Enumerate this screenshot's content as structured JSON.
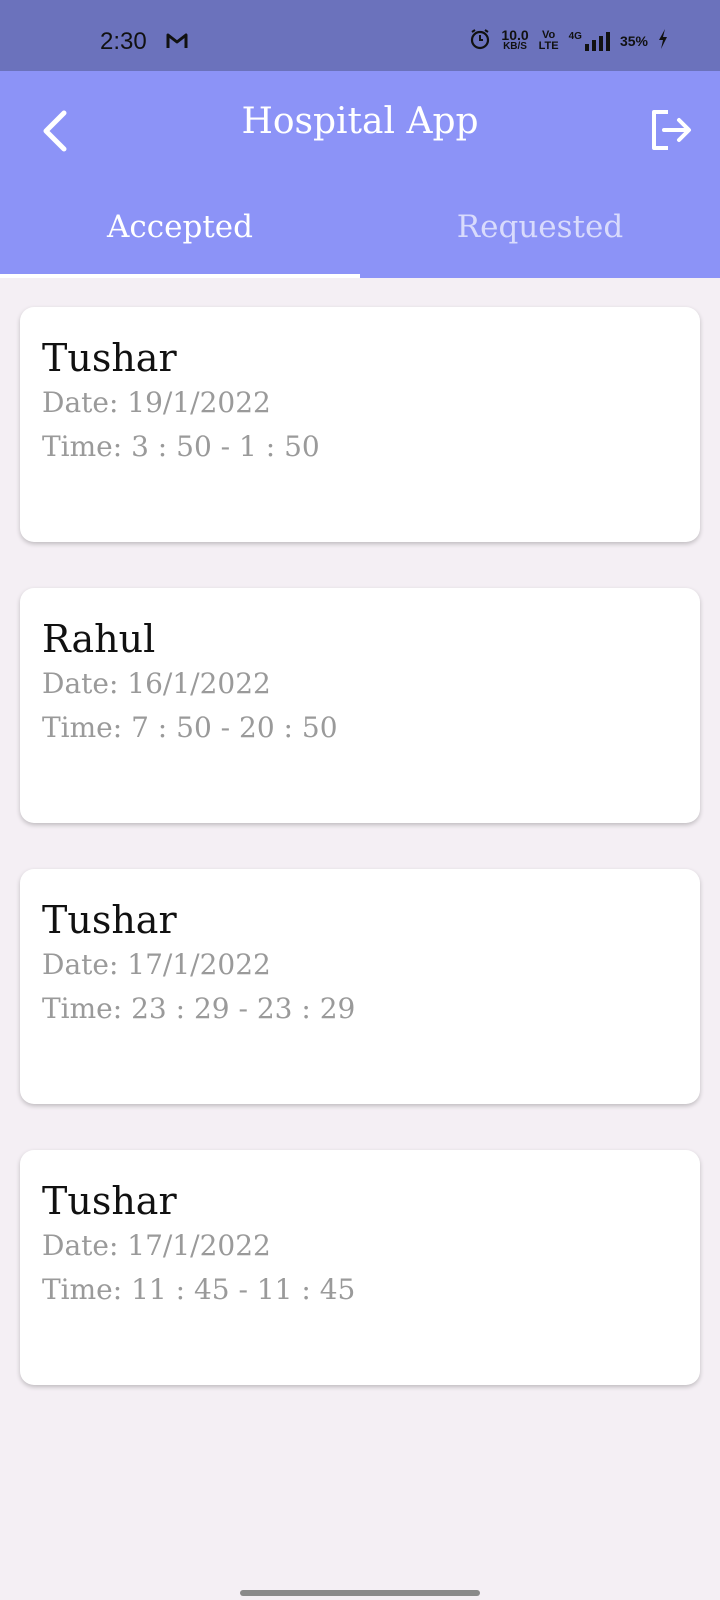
{
  "status_bar": {
    "time": "2:30",
    "speed_value": "10.0",
    "speed_unit": "KB/S",
    "volte_top": "Vo",
    "volte_bottom": "LTE",
    "network": "4G",
    "battery": "35%"
  },
  "app_bar": {
    "title": "Hospital App",
    "back_icon": "back-arrow-icon",
    "logout_icon": "logout-icon"
  },
  "tabs": [
    {
      "label": "Accepted",
      "active": true
    },
    {
      "label": "Requested",
      "active": false
    }
  ],
  "appointments": [
    {
      "name": "Tushar",
      "date": "Date: 19/1/2022",
      "time": "Time: 3 : 50 - 1 : 50"
    },
    {
      "name": "Rahul",
      "date": "Date: 16/1/2022",
      "time": "Time: 7 : 50 - 20 : 50"
    },
    {
      "name": "Tushar",
      "date": "Date: 17/1/2022",
      "time": "Time: 23 : 29 - 23 : 29"
    },
    {
      "name": "Tushar",
      "date": "Date: 17/1/2022",
      "time": "Time: 11 : 45 - 11 : 45"
    }
  ],
  "colors": {
    "status_bar": "#6b72bc",
    "app_bar": "#8c93f7",
    "background": "#f4eff4"
  }
}
